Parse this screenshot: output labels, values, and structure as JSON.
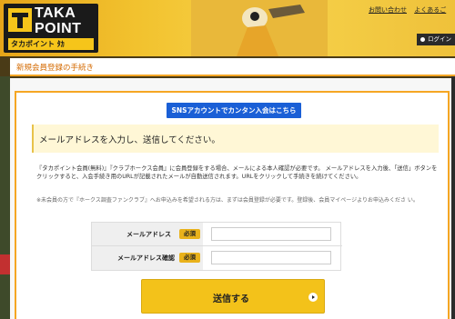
{
  "brand": {
    "logo_line1": "TAKA",
    "logo_line2": "POINT",
    "logo_sub": "タカポイント ﾀｶ"
  },
  "header": {
    "links": [
      "お問い合わせ",
      "よくあるご"
    ],
    "login_label": "ログイン"
  },
  "page": {
    "title": "新規会員登録の手続き"
  },
  "sns_button_label": "SNSアカウントでカンタン入会はこちら",
  "section": {
    "heading": "メールアドレスを入力し、送信してください。",
    "description": "『タカポイント会員(無料)』『クラブホークス会員』に会員登録をする場合、メールによる本人確認が必要です。 メールアドレスを入力後、「送信」ボタンをクリックすると、入会手続き用のURLが記載されたメールが自動送信されます。URLをクリックして手続きを続けてください。",
    "note": "※未会員の方で『ホークス調査ファンクラブ』へお申込みを希望される方は、まずは会員登録が必要です。登録後、会員マイページよりお申込みくださ い。"
  },
  "form": {
    "required_badge": "必須",
    "fields": [
      {
        "label": "メールアドレス",
        "value": "",
        "placeholder": ""
      },
      {
        "label": "メールアドレス確認",
        "value": "",
        "placeholder": ""
      }
    ]
  },
  "submit_label": "送信する",
  "colors": {
    "accent": "#f5a623",
    "brand_yellow": "#f3c21a",
    "sns_blue": "#1a5fd6",
    "title_orange": "#d46a00"
  }
}
